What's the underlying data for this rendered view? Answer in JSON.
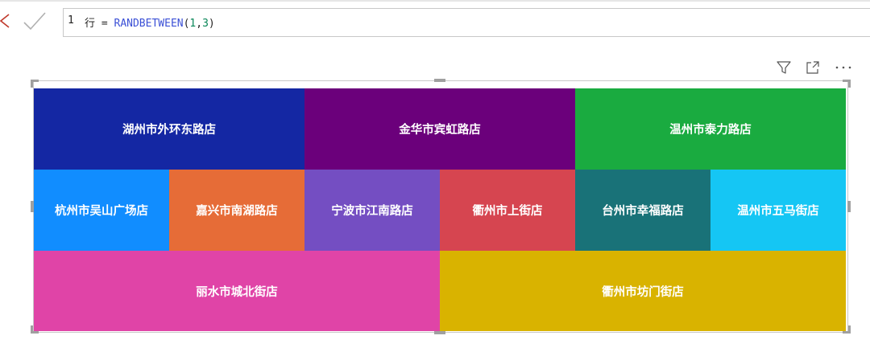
{
  "formula_bar": {
    "line_number": "1",
    "measure_name": "行",
    "equals": " = ",
    "function_name": "RANDBETWEEN",
    "open_paren": "(",
    "arg1": "1",
    "comma": ",",
    "arg2": "3",
    "close_paren": ")"
  },
  "visual_header": {
    "icons": [
      "filter-icon",
      "focus-mode-icon",
      "more-options-icon"
    ],
    "more_label": "···"
  },
  "treemap": {
    "rows": [
      [
        {
          "label": "湖州市外环东路店",
          "color": "#1427a3"
        },
        {
          "label": "金华市宾虹路店",
          "color": "#6b007b"
        },
        {
          "label": "温州市泰力路店",
          "color": "#1aab40"
        }
      ],
      [
        {
          "label": "杭州市吴山广场店",
          "color": "#118dff"
        },
        {
          "label": "嘉兴市南湖路店",
          "color": "#e66c37"
        },
        {
          "label": "宁波市江南路店",
          "color": "#744ec2"
        },
        {
          "label": "衢州市上街店",
          "color": "#d64550"
        },
        {
          "label": "台州市幸福路店",
          "color": "#197278"
        },
        {
          "label": "温州市五马街店",
          "color": "#15c6f4"
        }
      ],
      [
        {
          "label": "丽水市城北街店",
          "color": "#e044a7"
        },
        {
          "label": "衢州市坊门街店",
          "color": "#d9b300"
        }
      ]
    ]
  }
}
